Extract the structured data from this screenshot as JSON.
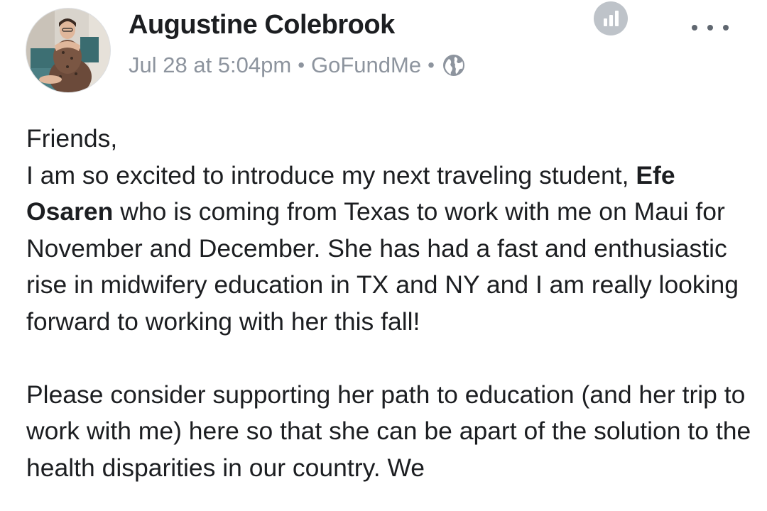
{
  "post": {
    "author": "Augustine Colebrook",
    "timestamp": "Jul 28 at 5:04pm",
    "separator": "•",
    "app": "GoFundMe",
    "icons": {
      "avatar": "profile-photo",
      "audience": "globe-icon",
      "insights": "insights-icon",
      "more": "more-horizontal-icon"
    },
    "body": {
      "greeting": "Friends,",
      "p1_before": "I am so excited to introduce my next traveling student, ",
      "p1_name": "Efe Osaren",
      "p1_after": " who is coming from Texas to work with me on Maui for November and December.  She has had a fast and enthusiastic rise in midwifery education in TX and NY and I am really looking forward to working with her this fall!",
      "p2": "Please consider supporting her path to education (and her trip to work with me) here so that she can be apart of the solution to the health disparities in our country. We"
    }
  },
  "colors": {
    "text": "#1c1e21",
    "meta": "#8d949e",
    "icon_gray": "#bec3c9"
  }
}
